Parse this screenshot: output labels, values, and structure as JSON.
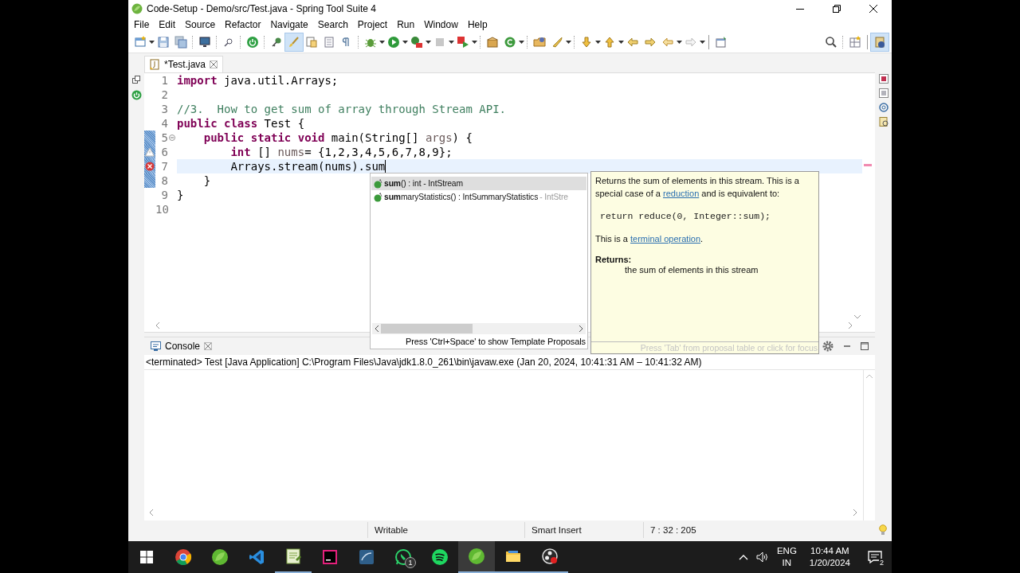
{
  "window": {
    "title": "Code-Setup - Demo/src/Test.java - Spring Tool Suite 4"
  },
  "menu": [
    "File",
    "Edit",
    "Source",
    "Refactor",
    "Navigate",
    "Search",
    "Project",
    "Run",
    "Window",
    "Help"
  ],
  "editor_tabs": [
    {
      "label": "*Test.java",
      "selected": true
    }
  ],
  "editor": {
    "lines": [
      {
        "number": "1",
        "tokens": [
          {
            "text": "import",
            "kind": "keyword"
          },
          {
            "text": " java.util.Arrays;",
            "kind": "plain"
          }
        ],
        "current": false,
        "warning": false,
        "error": false,
        "changed": false,
        "fold": false
      },
      {
        "number": "2",
        "current": false,
        "warning": false,
        "error": false,
        "changed": false,
        "fold": false
      },
      {
        "number": "3",
        "tokens": [
          {
            "text": "//3.  How to get sum of array through Stream API.",
            "kind": "comment"
          }
        ],
        "current": false,
        "warning": false,
        "error": false,
        "changed": false,
        "fold": false
      },
      {
        "number": "4",
        "tokens": [
          {
            "text": "public class",
            "kind": "keyword"
          },
          {
            "text": " Test {",
            "kind": "plain"
          }
        ],
        "current": false,
        "warning": false,
        "error": false,
        "changed": false,
        "fold": false
      },
      {
        "number": "5",
        "tokens": [
          {
            "text": "    public static void",
            "kind": "keyword"
          },
          {
            "text": " main(String[] ",
            "kind": "plain"
          },
          {
            "text": "args",
            "kind": "variable"
          },
          {
            "text": ") {",
            "kind": "plain"
          }
        ],
        "current": false,
        "warning": false,
        "error": false,
        "changed": true,
        "fold": true
      },
      {
        "number": "6",
        "tokens": [
          {
            "text": "        int",
            "kind": "keyword"
          },
          {
            "text": " [] ",
            "kind": "plain"
          },
          {
            "text": "nums",
            "kind": "variable"
          },
          {
            "text": "= {1,2,3,4,5,6,7,8,9};",
            "kind": "plain"
          }
        ],
        "current": false,
        "warning": true,
        "error": false,
        "changed": true,
        "fold": false
      },
      {
        "number": "7",
        "tokens": [
          {
            "text": "        Arrays.stream(nums).sum",
            "kind": "plain"
          }
        ],
        "current": true,
        "warning": false,
        "error": true,
        "changed": true,
        "fold": false
      },
      {
        "number": "8",
        "tokens": [
          {
            "text": "    }",
            "kind": "plain"
          }
        ],
        "current": false,
        "warning": false,
        "error": false,
        "changed": true,
        "fold": false
      },
      {
        "number": "9",
        "tokens": [
          {
            "text": "}",
            "kind": "plain"
          }
        ],
        "current": false,
        "warning": false,
        "error": false,
        "changed": false,
        "fold": false
      },
      {
        "number": "10",
        "current": false,
        "warning": false,
        "error": false,
        "changed": false,
        "fold": false
      }
    ]
  },
  "proposals": {
    "items": [
      {
        "label": "**sum**() : int - IntStream",
        "selected": true
      },
      {
        "label": "**sum**maryStatistics() : IntSummaryStatistics",
        "qualifier": " - IntStre",
        "selected": false
      }
    ],
    "footer": "Press 'Ctrl+Space' to show Template Proposals"
  },
  "doc": {
    "blocks": [
      {
        "kind": "paragraph",
        "parts": [
          {
            "text": "Returns the sum of elements in this stream. This is a special case of a ",
            "kind": "text"
          },
          {
            "text": "reduction",
            "kind": "link"
          },
          {
            "text": " and is equivalent to:",
            "kind": "text"
          }
        ]
      },
      {
        "kind": "code",
        "text": "return reduce(0, Integer::sum);"
      },
      {
        "kind": "paragraph",
        "parts": [
          {
            "text": "This is a ",
            "kind": "text"
          },
          {
            "text": "terminal operation",
            "kind": "link"
          },
          {
            "text": ".",
            "kind": "text"
          }
        ]
      },
      {
        "kind": "heading",
        "text": "Returns:"
      },
      {
        "kind": "indent",
        "text": "the sum of elements in this stream"
      }
    ],
    "footer": "Press 'Tab' from proposal table or click for focus"
  },
  "console": {
    "tab": "Console",
    "header": "<terminated> Test [Java Application] C:\\Program Files\\Java\\jdk1.8.0_261\\bin\\javaw.exe  (Jan 20, 2024, 10:41:31 AM – 10:41:32 AM)"
  },
  "status_bar": [
    "Writable",
    "Smart Insert",
    "7 : 32 : 205"
  ],
  "taskbar": {
    "items": [
      {
        "kind": "chrome",
        "active": false,
        "running": false
      },
      {
        "kind": "spring",
        "active": false,
        "running": false
      },
      {
        "kind": "vscode",
        "active": false,
        "running": false
      },
      {
        "kind": "notepad",
        "active": false,
        "running": true
      },
      {
        "kind": "intellij",
        "active": false,
        "running": false
      },
      {
        "kind": "database",
        "active": false,
        "running": false
      },
      {
        "kind": "chat",
        "active": false,
        "running": false,
        "badge": "1"
      },
      {
        "kind": "music",
        "active": false,
        "running": false
      },
      {
        "kind": "spring",
        "active": true,
        "running": true
      },
      {
        "kind": "folder",
        "active": false,
        "running": true
      },
      {
        "kind": "recorder",
        "active": false,
        "running": true
      }
    ],
    "tray": {
      "language": "ENG",
      "region": "IN",
      "time": "10:44 AM",
      "date": "1/20/2024",
      "notifications": "2"
    }
  }
}
